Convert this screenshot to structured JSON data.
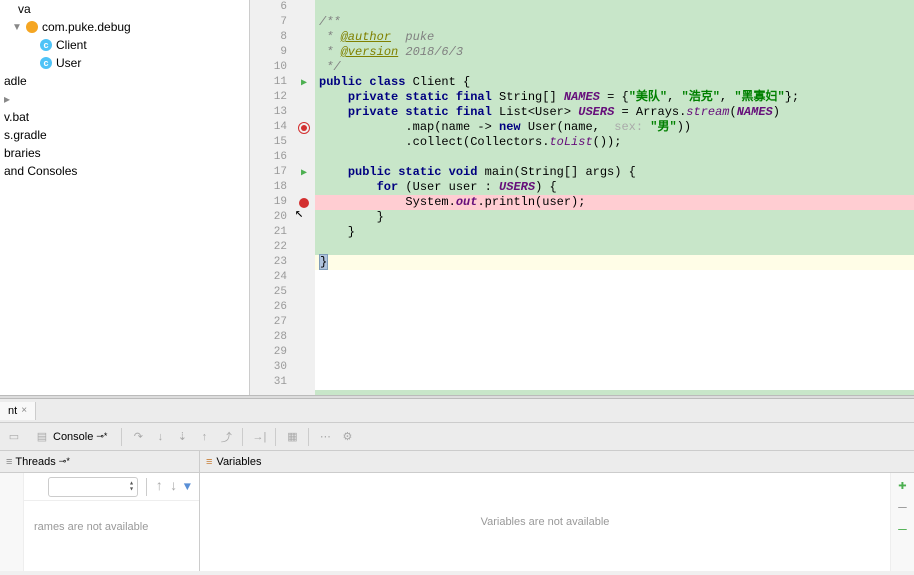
{
  "sidebar": {
    "items": [
      {
        "label": "va",
        "type": "plain"
      },
      {
        "label": "com.puke.debug",
        "type": "package"
      },
      {
        "label": "Client",
        "type": "class"
      },
      {
        "label": "User",
        "type": "class"
      },
      {
        "label": "adle",
        "type": "plain"
      },
      {
        "label": "",
        "type": "blank"
      },
      {
        "label": "v.bat",
        "type": "plain"
      },
      {
        "label": "s.gradle",
        "type": "plain"
      },
      {
        "label": "braries",
        "type": "plain"
      },
      {
        "label": "and Consoles",
        "type": "plain"
      }
    ]
  },
  "editor": {
    "lines": [
      {
        "n": "6",
        "html": ""
      },
      {
        "n": "7",
        "html": "<span class='comment'>/**</span>"
      },
      {
        "n": "8",
        "html": "<span class='comment'> * </span><span class='anno'>@author</span><span class='comment'>  puke</span>"
      },
      {
        "n": "9",
        "html": "<span class='comment'> * </span><span class='anno'>@version</span><span class='comment'> 2018/6/3</span>"
      },
      {
        "n": "10",
        "html": "<span class='comment'> */</span>"
      },
      {
        "n": "11",
        "html": "<span class='kw'>public class</span> Client {",
        "marker": "run"
      },
      {
        "n": "12",
        "html": "    <span class='kw'>private static final</span> String[] <span class='ident-b'>NAMES</span> = {<span class='str'>\"美队\"</span>, <span class='str'>\"浩克\"</span>, <span class='str'>\"黑寡妇\"</span>};"
      },
      {
        "n": "13",
        "html": "    <span class='kw'>private static final</span> List&lt;User&gt; <span class='ident-b'>USERS</span> = Arrays.<span class='ident'>stream</span>(<span class='ident-b'>NAMES</span>)"
      },
      {
        "n": "14",
        "html": "            .map(name -> <span class='kw'>new</span> User(name,  <span class='hint'>sex:</span> <span class='str'>\"男\"</span>))",
        "marker": "bp-target"
      },
      {
        "n": "15",
        "html": "            .collect(Collectors.<span class='ident'>toList</span>());"
      },
      {
        "n": "16",
        "html": ""
      },
      {
        "n": "17",
        "html": "    <span class='kw'>public static void</span> main(String[] args) {",
        "marker": "run"
      },
      {
        "n": "18",
        "html": "        <span class='kw'>for</span> (User user : <span class='ident-b'>USERS</span>) {"
      },
      {
        "n": "19",
        "html": "            System.<span class='ident-b'>out</span>.println(user);",
        "marker": "bp-fill",
        "cls": "bp-line"
      },
      {
        "n": "20",
        "html": "        }"
      },
      {
        "n": "21",
        "html": "    }"
      },
      {
        "n": "22",
        "html": ""
      },
      {
        "n": "23",
        "html": "<span class='brace-hl'>}</span>",
        "cls": "highlight"
      },
      {
        "n": "24",
        "html": "",
        "cls": "white-bg"
      },
      {
        "n": "25",
        "html": "",
        "cls": "white-bg"
      },
      {
        "n": "26",
        "html": "",
        "cls": "white-bg"
      },
      {
        "n": "27",
        "html": "",
        "cls": "white-bg"
      },
      {
        "n": "28",
        "html": "",
        "cls": "white-bg"
      },
      {
        "n": "29",
        "html": "",
        "cls": "white-bg"
      },
      {
        "n": "30",
        "html": "",
        "cls": "white-bg"
      },
      {
        "n": "31",
        "html": "",
        "cls": "white-bg"
      }
    ]
  },
  "debug_tab": {
    "label": "nt"
  },
  "toolbar": {
    "console_label": "Console"
  },
  "debug": {
    "threads_label": "Threads",
    "variables_label": "Variables",
    "frames_msg": "rames are not available",
    "vars_msg": "Variables are not available"
  }
}
